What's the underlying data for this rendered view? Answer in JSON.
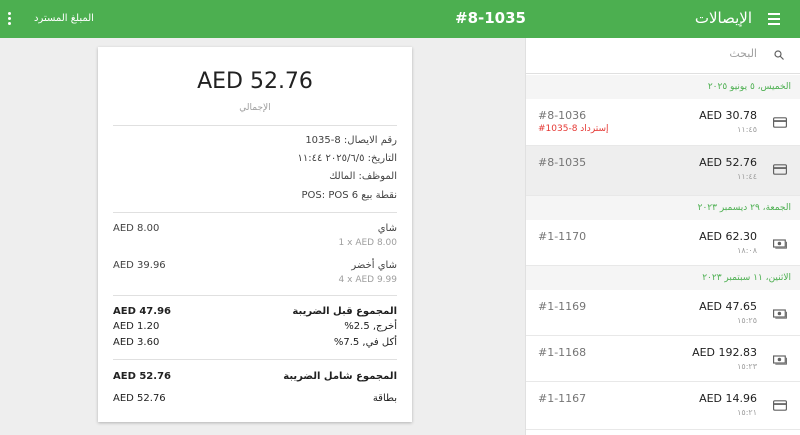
{
  "appbar": {
    "title": "الإيصالات",
    "receipt_number": "#8-1035",
    "refund_action": "المبلغ المسترد"
  },
  "search": {
    "placeholder": "البحث"
  },
  "receipt_list": {
    "groups": [
      {
        "date": "الخميس، ٥ يونيو ٢٠٢٥",
        "rows": [
          {
            "number": "#8-1036",
            "refund_note": "إسترداد 8-1035#",
            "amount": "AED 30.78",
            "time": "١١:٤٥",
            "payment_icon": "card-icon"
          },
          {
            "number": "#8-1035",
            "amount": "AED 52.76",
            "time": "١١:٤٤",
            "payment_icon": "card-icon"
          }
        ]
      },
      {
        "date": "الجمعة، ٢٩ ديسمبر ٢٠٢٣",
        "rows": [
          {
            "number": "#1-1170",
            "amount": "AED 62.30",
            "time": "١٨:٠٨",
            "payment_icon": "cash-icon"
          }
        ]
      },
      {
        "date": "الاثنين، ١١ سبتمبر ٢٠٢٣",
        "rows": [
          {
            "number": "#1-1169",
            "amount": "AED 47.65",
            "time": "١٥:٢٥",
            "payment_icon": "cash-icon"
          },
          {
            "number": "#1-1168",
            "amount": "AED 192.83",
            "time": "١٥:٢٣",
            "payment_icon": "cash-icon"
          },
          {
            "number": "#1-1167",
            "amount": "AED 14.96",
            "time": "١٥:٢١",
            "payment_icon": "card-icon"
          }
        ]
      }
    ]
  },
  "receipt": {
    "total": "AED 52.76",
    "total_caption": "الإجمالي",
    "info": [
      "رقم الايصال: 8-1035",
      "التاريخ: ٢٠٢٥/٦/٥ ١١:٤٤",
      "الموظف: المالك",
      "نقطة بيع POS: POS 6"
    ],
    "items": [
      {
        "name": "شاي",
        "qty": "1 x AED 8.00",
        "amount": "AED 8.00"
      },
      {
        "name": "شاي أخضر",
        "qty": "4 x AED 9.99",
        "amount": "AED 39.96"
      }
    ],
    "subtotal_label": "المجموع قبل الضريبة",
    "subtotal_amount": "AED 47.96",
    "taxes": [
      {
        "label": "أخرج, 2.5%",
        "amount": "AED 1.20"
      },
      {
        "label": "أكل في, 7.5%",
        "amount": "AED 3.60"
      }
    ],
    "total_with_tax_label": "المجموع شامل الضريبة",
    "total_with_tax_amount": "AED 52.76",
    "payment_label": "بطاقة",
    "payment_amount": "AED 52.76"
  },
  "colors": {
    "accent": "#4caf50",
    "refund": "#e53935",
    "selected_row": "#eeeeee"
  }
}
